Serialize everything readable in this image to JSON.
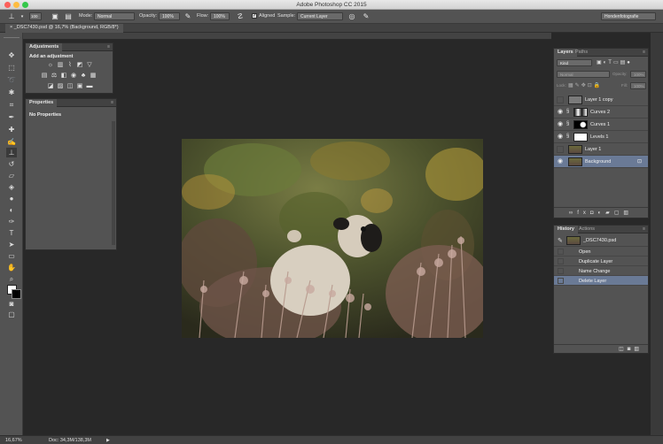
{
  "window": {
    "title": "Adobe Photoshop CC 2015"
  },
  "options_bar": {
    "brush_size": "100",
    "mode_label": "Mode:",
    "mode_value": "Normal",
    "opacity_label": "Opacity:",
    "opacity_value": "100%",
    "flow_label": "Flow:",
    "flow_value": "100%",
    "aligned_label": "Aligned",
    "sample_label": "Sample:",
    "sample_value": "Current Layer",
    "workspace_value": "Hondenfotografie"
  },
  "document_tab": {
    "label": "_DSC7430.psd @ 16,7% (Background, RGB/8*)"
  },
  "adjustments_panel": {
    "tab": "Adjustments",
    "heading": "Add an adjustment"
  },
  "properties_panel": {
    "tab": "Properties",
    "message": "No Properties"
  },
  "layers_panel": {
    "tabs": [
      "Layers",
      "Paths"
    ],
    "filter_value": "Kind",
    "blend_value": "Normal",
    "opacity_label": "Opacity:",
    "opacity_value": "100%",
    "lock_label": "Lock:",
    "fill_label": "Fill:",
    "fill_value": "100%",
    "layers": [
      {
        "name": "Layer 1 copy",
        "visible": false,
        "selected": false
      },
      {
        "name": "Curves 2",
        "visible": true,
        "selected": false
      },
      {
        "name": "Curves 1",
        "visible": true,
        "selected": false
      },
      {
        "name": "Levels 1",
        "visible": true,
        "selected": false
      },
      {
        "name": "Layer 1",
        "visible": false,
        "selected": false
      },
      {
        "name": "Background",
        "visible": true,
        "selected": true
      }
    ]
  },
  "history_panel": {
    "tabs": [
      "History",
      "Actions"
    ],
    "snapshot": "_DSC7430.psd",
    "items": [
      "Open",
      "Duplicate Layer",
      "Name Change",
      "Delete Layer"
    ],
    "selected_index": 3
  },
  "status_bar": {
    "zoom": "16,67%",
    "doc_info": "Doc: 34,3M/138,3M"
  },
  "colors": {
    "panel": "#535353",
    "background": "#282828",
    "selection": "#6a7a96"
  }
}
